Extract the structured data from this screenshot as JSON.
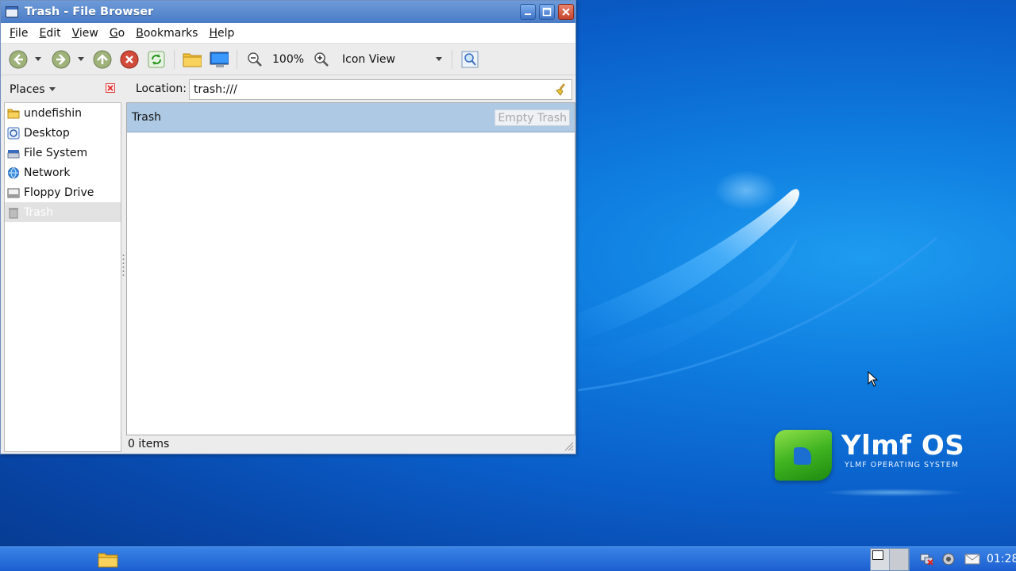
{
  "window": {
    "title": "Trash - File Browser",
    "menu": [
      "File",
      "Edit",
      "View",
      "Go",
      "Bookmarks",
      "Help"
    ],
    "menu_mnemonics": [
      "F",
      "E",
      "V",
      "G",
      "B",
      "H"
    ],
    "toolbar": {
      "zoom": "100%",
      "view_mode": "Icon View"
    },
    "places_label": "Places",
    "location_label": "Location:",
    "location_value": "trash:///",
    "sidebar_items": [
      {
        "label": "undefishin",
        "icon": "home-folder-icon"
      },
      {
        "label": "Desktop",
        "icon": "desktop-icon"
      },
      {
        "label": "File System",
        "icon": "drive-icon"
      },
      {
        "label": "Network",
        "icon": "network-icon"
      },
      {
        "label": "Floppy Drive",
        "icon": "floppy-icon"
      },
      {
        "label": "Trash",
        "icon": "trash-icon"
      }
    ],
    "trash_bar_label": "Trash",
    "empty_trash_label": "Empty Trash",
    "status": "0 items"
  },
  "desktop": {
    "brand_name": "Ylmf OS",
    "brand_sub": "YLMF OPERATING SYSTEM"
  },
  "taskbar": {
    "clock": "01:28"
  },
  "colors": {
    "titlebar": "#5a8bd0",
    "selection": "#adc9e4",
    "desktop": "#0a5ec9",
    "taskbar": "#2a6fdb"
  }
}
